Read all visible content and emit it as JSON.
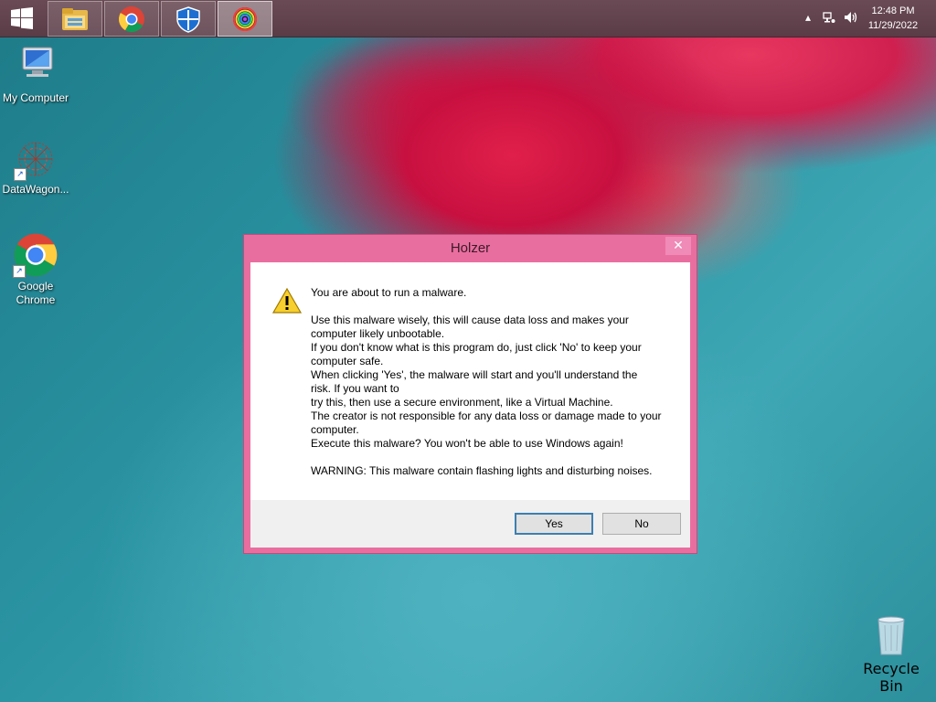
{
  "taskbar": {
    "pinned": [
      {
        "icon": "file-explorer-icon"
      },
      {
        "icon": "google-chrome-icon"
      },
      {
        "icon": "windows-defender-icon"
      },
      {
        "icon": "holzer-app-icon",
        "active": true
      }
    ],
    "tray": {
      "icons": [
        "show-hidden-icons-icon",
        "network-icon",
        "volume-icon"
      ],
      "time": "12:48 PM",
      "date": "11/29/2022"
    }
  },
  "desktop": {
    "icons": [
      {
        "label": "My Computer",
        "icon": "my-computer-icon"
      },
      {
        "label": "DataWagon...",
        "icon": "datawagon-icon"
      },
      {
        "label": "Google\nChrome",
        "icon": "google-chrome-icon"
      },
      {
        "label": "Recycle Bin",
        "icon": "recycle-bin-icon"
      }
    ]
  },
  "dialog": {
    "title": "Holzer",
    "close": "✕",
    "icon": "warning-icon",
    "lines": [
      "You are about to run a malware.",
      "",
      "Use this malware wisely, this will cause data loss and makes your",
      "computer likely unbootable.",
      "If you don't know what is this program do, just click 'No' to keep your",
      "computer safe.",
      "When clicking 'Yes', the malware will start and you'll understand the",
      "risk. If you want to",
      "try this, then use a secure environment, like a Virtual Machine.",
      "The creator is not responsible for any data loss or damage made to your",
      "computer.",
      "Execute this malware? You won't be able to use Windows again!",
      "",
      "WARNING: This malware contain flashing lights and disturbing noises."
    ],
    "yes_label": "Yes",
    "no_label": "No"
  },
  "colors": {
    "dialog_frame": "#e96ea0",
    "taskbar": "#5f4149",
    "desktop": "#2a93a2"
  }
}
